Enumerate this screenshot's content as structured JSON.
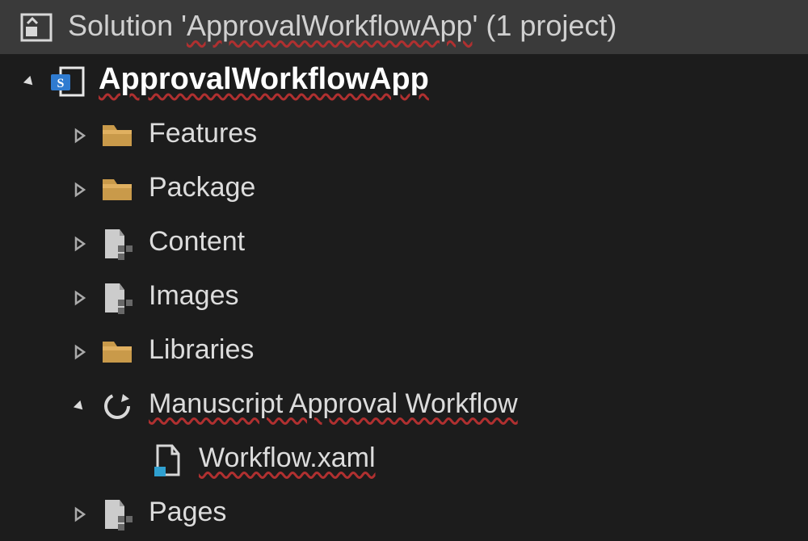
{
  "solution": {
    "prefix": "Solution '",
    "name": "ApprovalWorkflowApp",
    "suffix": "' (1 project)"
  },
  "tree": [
    {
      "indent": 0,
      "expander": "open",
      "icon": "sharepoint-project",
      "label": "ApprovalWorkflowApp",
      "bold": true,
      "spell": true
    },
    {
      "indent": 1,
      "expander": "closed",
      "icon": "folder",
      "label": "Features",
      "spell": false
    },
    {
      "indent": 1,
      "expander": "closed",
      "icon": "folder",
      "label": "Package",
      "spell": false
    },
    {
      "indent": 1,
      "expander": "closed",
      "icon": "module",
      "label": "Content",
      "spell": false
    },
    {
      "indent": 1,
      "expander": "closed",
      "icon": "module",
      "label": "Images",
      "spell": false
    },
    {
      "indent": 1,
      "expander": "closed",
      "icon": "folder",
      "label": "Libraries",
      "spell": false
    },
    {
      "indent": 1,
      "expander": "open",
      "icon": "workflow",
      "label": "Manuscript Approval Workflow",
      "spell": true
    },
    {
      "indent": 2,
      "expander": "none",
      "icon": "xaml-file",
      "label": "Workflow.xaml",
      "spell": true
    },
    {
      "indent": 1,
      "expander": "closed",
      "icon": "module",
      "label": "Pages",
      "spell": false
    }
  ]
}
